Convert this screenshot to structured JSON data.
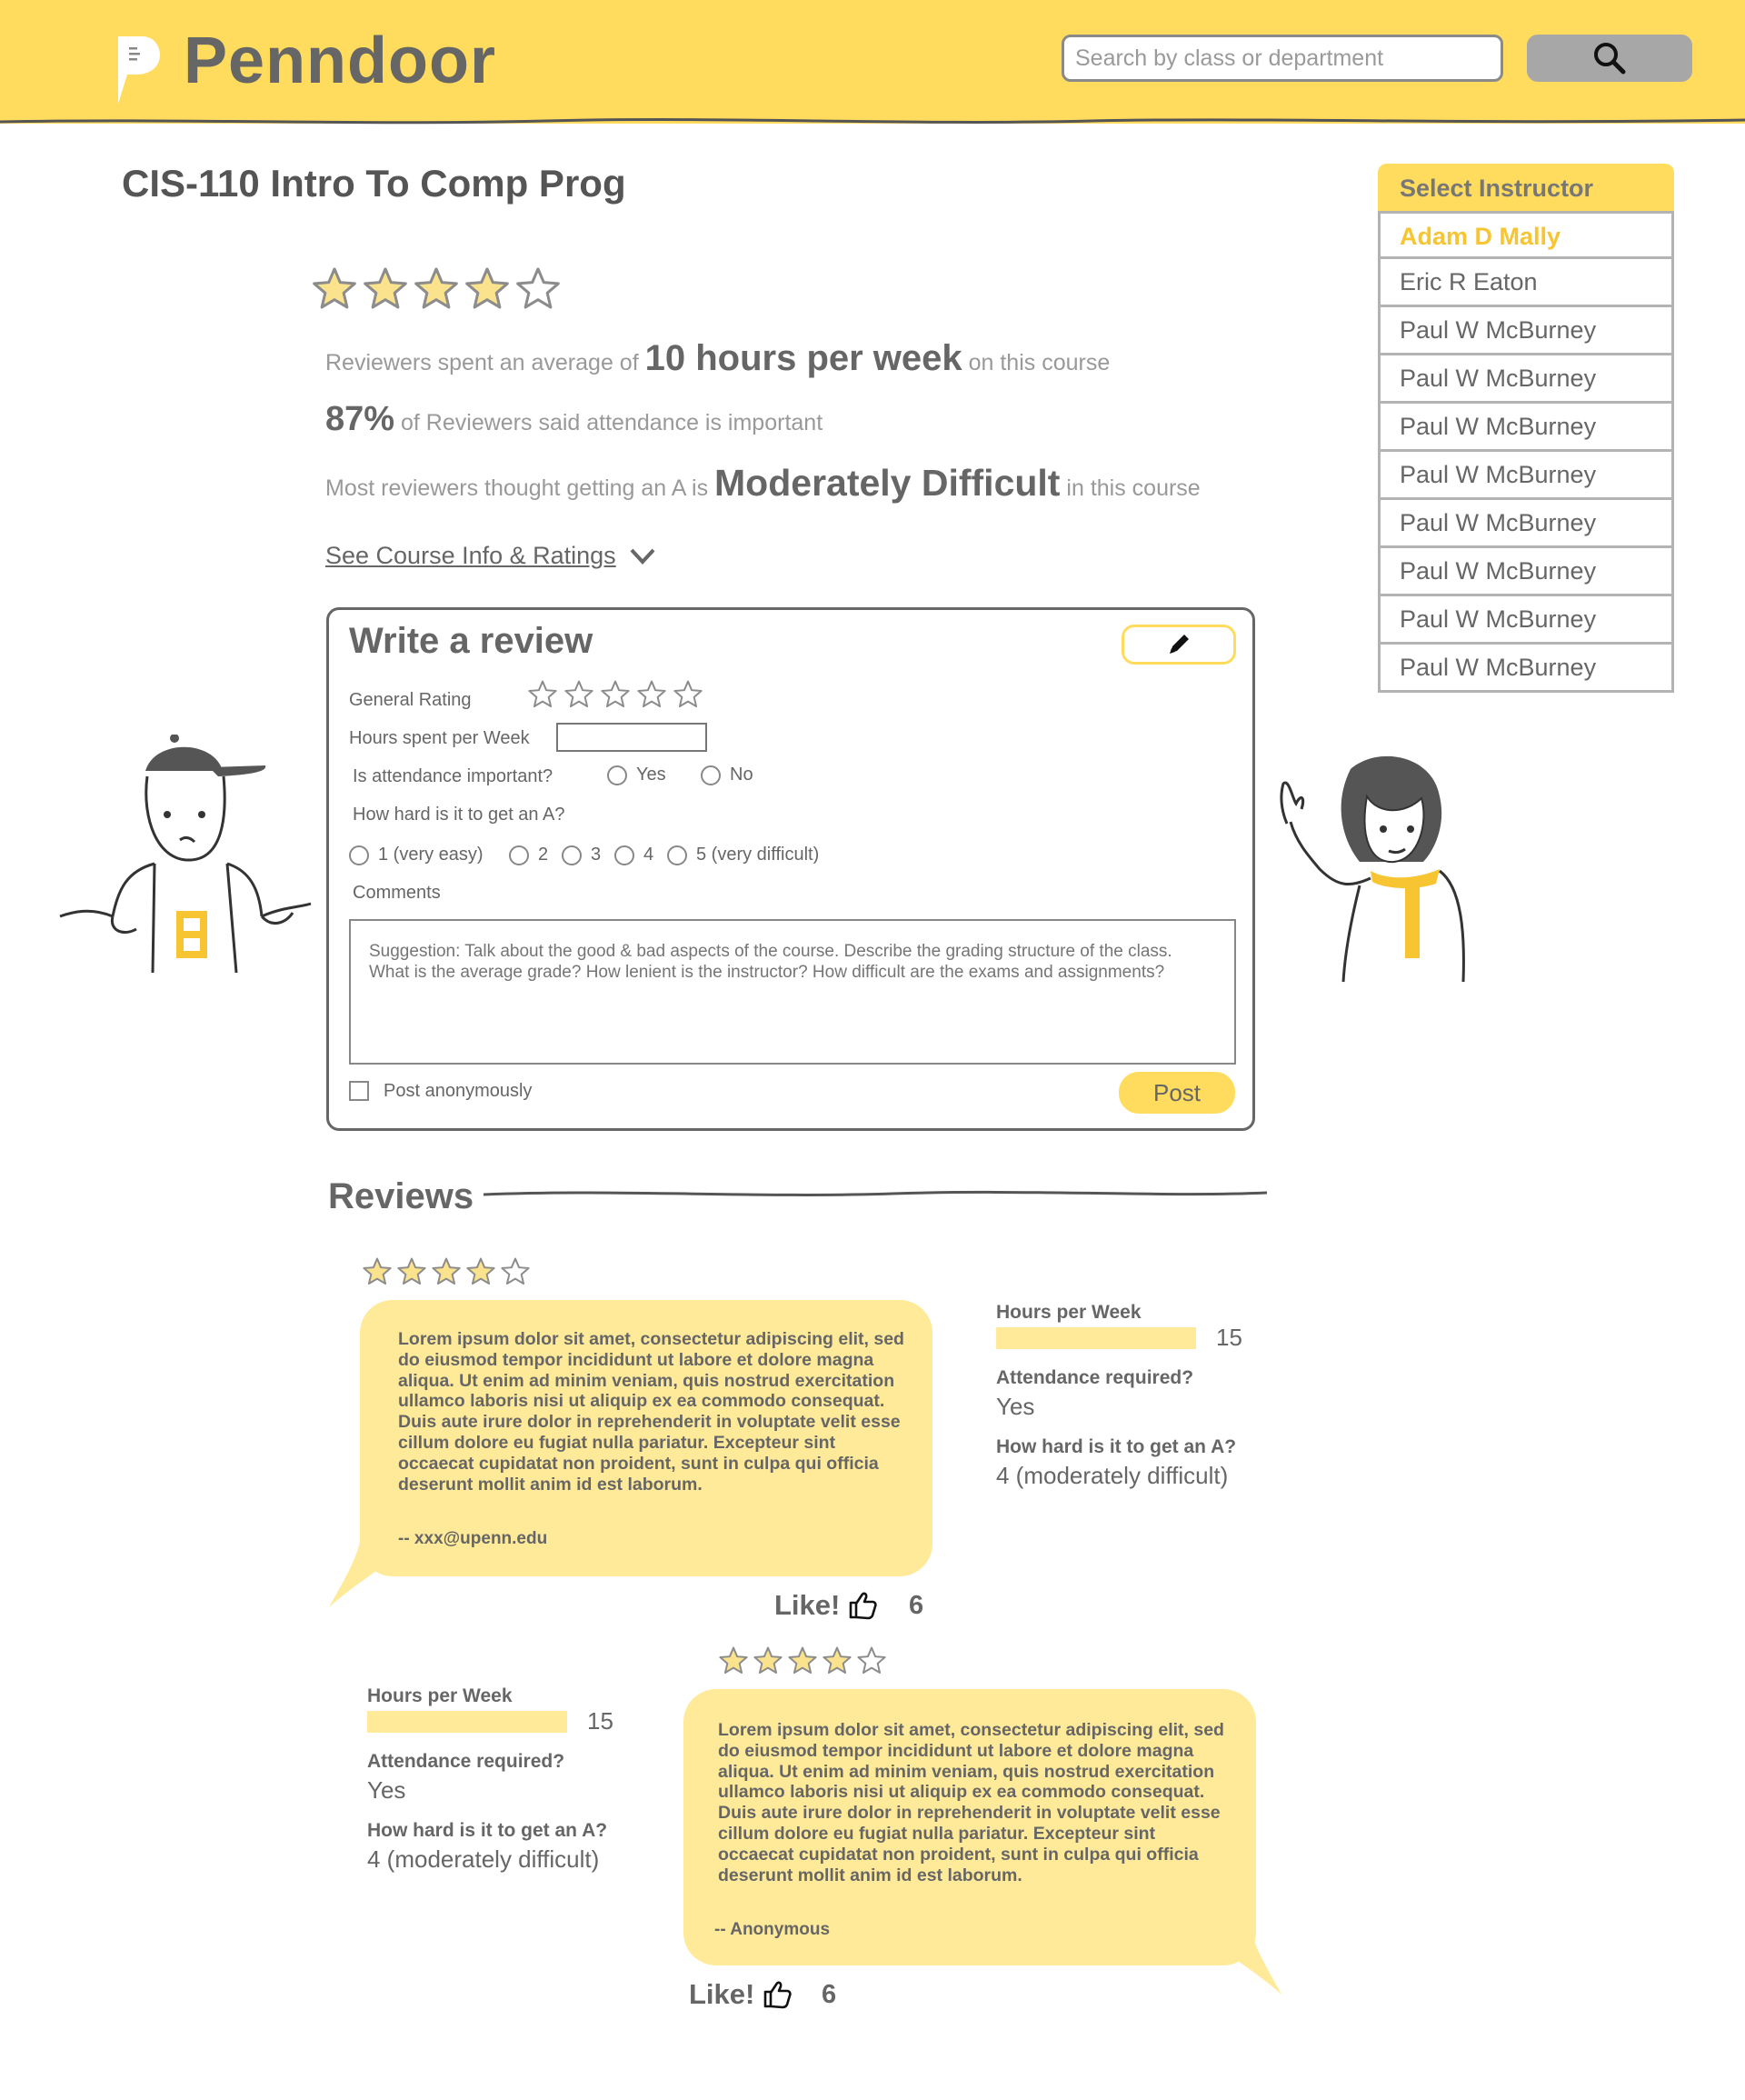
{
  "header": {
    "brand": "Penndoor",
    "search_placeholder": "Search by class or department"
  },
  "course": {
    "title": "CIS-110 Intro To Comp Prog",
    "rating": 4,
    "rating_max": 5,
    "hours_prefix": "Reviewers spent an average of",
    "hours_value": "10 hours per week",
    "hours_suffix": "on this course",
    "attendance_value": "87%",
    "attendance_suffix": "of Reviewers said attendance is important",
    "difficulty_prefix": "Most reviewers thought getting an A is",
    "difficulty_value": "Moderately Difficult",
    "difficulty_suffix": "in this course",
    "see_info": "See Course Info & Ratings"
  },
  "instructors": {
    "heading": "Select Instructor",
    "items": [
      {
        "name": "Adam D Mally",
        "active": true
      },
      {
        "name": "Eric R Eaton"
      },
      {
        "name": "Paul W McBurney"
      },
      {
        "name": "Paul W McBurney"
      },
      {
        "name": "Paul W McBurney"
      },
      {
        "name": "Paul W McBurney"
      },
      {
        "name": "Paul W McBurney"
      },
      {
        "name": "Paul W McBurney"
      },
      {
        "name": "Paul W McBurney"
      },
      {
        "name": "Paul W McBurney"
      }
    ]
  },
  "write_review": {
    "title": "Write a review",
    "general_rating_label": "General Rating",
    "hours_label": "Hours spent per Week",
    "attendance_label": "Is attendance important?",
    "attendance_options": [
      "Yes",
      "No"
    ],
    "difficulty_label": "How hard is it to get an A?",
    "difficulty_options": [
      "1 (very easy)",
      "2",
      "3",
      "4",
      "5 (very difficult)"
    ],
    "comments_label": "Comments",
    "comments_placeholder": "Suggestion: Talk about the good & bad aspects of the course. Describe the grading structure of the class. What is the average grade? How lenient is the instructor? How difficult are the exams and assignments?",
    "anonymous_label": "Post anonymously",
    "post_label": "Post"
  },
  "reviews": {
    "heading": "Reviews",
    "items": [
      {
        "rating": 4,
        "text": "Lorem ipsum dolor sit amet, consectetur adipiscing elit, sed do eiusmod tempor incididunt ut labore et dolore magna aliqua. Ut enim ad minim veniam, quis nostrud exercitation ullamco laboris nisi ut aliquip ex ea commodo consequat. Duis aute irure dolor in reprehenderit in voluptate velit esse cillum dolore eu fugiat nulla pariatur. Excepteur sint occaecat cupidatat non proident, sunt in culpa qui officia deserunt mollit anim id est laborum.",
        "author": "-- xxx@upenn.edu",
        "hours_label": "Hours per Week",
        "hours": "15",
        "attendance_label": "Attendance required?",
        "attendance": "Yes",
        "difficulty_label": "How hard is it to get an A?",
        "difficulty": "4 (moderately difficult)",
        "like_label": "Like!",
        "likes": "6"
      },
      {
        "rating": 4,
        "text": "Lorem ipsum dolor sit amet, consectetur adipiscing elit, sed do eiusmod tempor incididunt ut labore et dolore magna aliqua. Ut enim ad minim veniam, quis nostrud exercitation ullamco laboris nisi ut aliquip ex ea commodo consequat. Duis aute irure dolor in reprehenderit in voluptate velit esse cillum dolore eu fugiat nulla pariatur. Excepteur sint occaecat cupidatat non proident, sunt in culpa qui officia deserunt mollit anim id est laborum.",
        "author": "-- Anonymous",
        "hours_label": "Hours per Week",
        "hours": "15",
        "attendance_label": "Attendance required?",
        "attendance": "Yes",
        "difficulty_label": "How hard is it to get an A?",
        "difficulty": "4 (moderately difficult)",
        "like_label": "Like!",
        "likes": "6"
      }
    ]
  },
  "colors": {
    "brand_yellow": "#FFDC5D",
    "bubble_yellow": "#FFEA99",
    "star_fill": "#FBE38D",
    "text_gray": "#666666",
    "active_instructor": "#F6C531"
  }
}
